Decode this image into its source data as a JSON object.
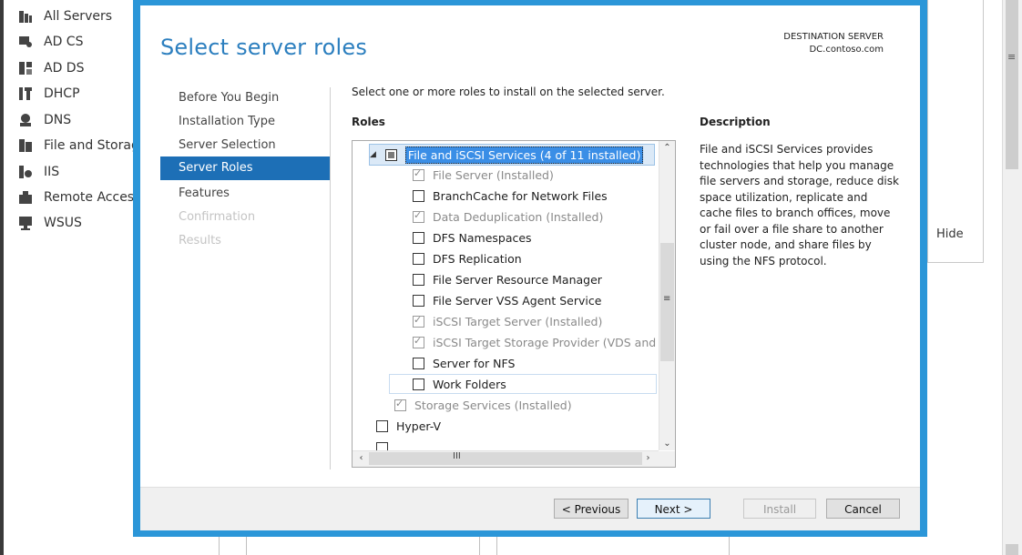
{
  "nav": {
    "items": [
      {
        "label": "All Servers",
        "icon": "servers-icon"
      },
      {
        "label": "AD CS",
        "icon": "certificate-icon"
      },
      {
        "label": "AD DS",
        "icon": "directory-icon"
      },
      {
        "label": "DHCP",
        "icon": "dhcp-icon"
      },
      {
        "label": "DNS",
        "icon": "dns-icon"
      },
      {
        "label": "File and Storag",
        "icon": "file-storage-icon"
      },
      {
        "label": "IIS",
        "icon": "iis-icon"
      },
      {
        "label": "Remote Access",
        "icon": "remote-access-icon"
      },
      {
        "label": "WSUS",
        "icon": "wsus-icon"
      }
    ]
  },
  "background": {
    "hide_label": "Hide"
  },
  "wizard": {
    "title": "Select server roles",
    "destination_label": "DESTINATION SERVER",
    "destination_value": "DC.contoso.com",
    "steps": [
      {
        "label": "Before You Begin",
        "state": "normal"
      },
      {
        "label": "Installation Type",
        "state": "normal"
      },
      {
        "label": "Server Selection",
        "state": "normal"
      },
      {
        "label": "Server Roles",
        "state": "active"
      },
      {
        "label": "Features",
        "state": "normal"
      },
      {
        "label": "Confirmation",
        "state": "disabled"
      },
      {
        "label": "Results",
        "state": "disabled"
      }
    ],
    "instruction": "Select one or more roles to install on the selected server.",
    "roles_header": "Roles",
    "description_header": "Description",
    "description": "File and iSCSI Services provides technologies that help you manage file servers and storage, reduce disk space utilization, replicate and cache files to branch offices, move or fail over a file share to another cluster node, and share files by using the NFS protocol.",
    "roles": [
      {
        "label": "File and iSCSI Services (4 of 11 installed)",
        "state": "partial",
        "installed": false
      },
      {
        "label": "File Server (Installed)",
        "state": "checked",
        "installed": true
      },
      {
        "label": "BranchCache for Network Files",
        "state": "unchecked",
        "installed": false
      },
      {
        "label": "Data Deduplication (Installed)",
        "state": "checked",
        "installed": true
      },
      {
        "label": "DFS Namespaces",
        "state": "unchecked",
        "installed": false
      },
      {
        "label": "DFS Replication",
        "state": "unchecked",
        "installed": false
      },
      {
        "label": "File Server Resource Manager",
        "state": "unchecked",
        "installed": false
      },
      {
        "label": "File Server VSS Agent Service",
        "state": "unchecked",
        "installed": false
      },
      {
        "label": "iSCSI Target Server (Installed)",
        "state": "checked",
        "installed": true
      },
      {
        "label": "iSCSI Target Storage Provider (VDS and VSS",
        "state": "checked",
        "installed": true
      },
      {
        "label": "Server for NFS",
        "state": "unchecked",
        "installed": false
      },
      {
        "label": "Work Folders",
        "state": "unchecked",
        "installed": false
      },
      {
        "label": "Storage Services (Installed)",
        "state": "checked",
        "installed": true
      },
      {
        "label": "Hyper-V",
        "state": "unchecked",
        "installed": false
      }
    ],
    "buttons": {
      "previous": "< Previous",
      "next": "Next >",
      "install": "Install",
      "cancel": "Cancel"
    }
  },
  "colors": {
    "accent": "#2b96d8",
    "selection": "#1d6fb6",
    "title": "#2c7fbf"
  }
}
